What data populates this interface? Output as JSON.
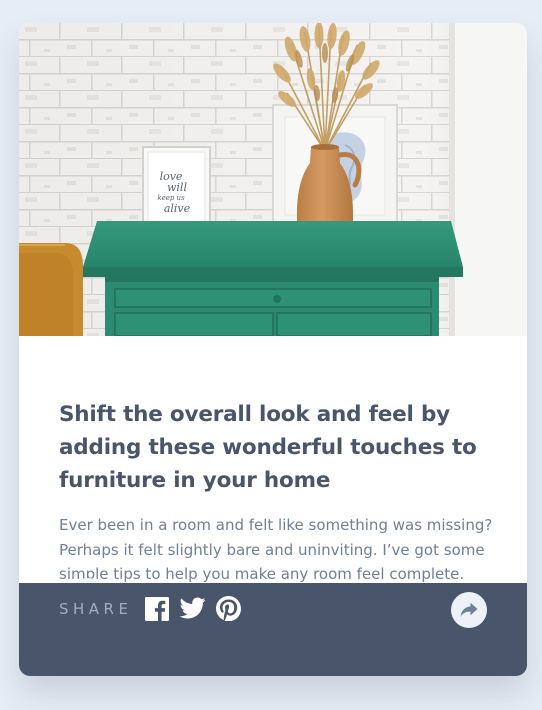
{
  "article": {
    "title": "Shift the overall look and feel by adding these wonderful touches to furniture in your home",
    "description": "Ever been in a room and felt like something was missing? Perhaps it felt slightly bare and uninviting. I’ve got some simple tips to help you make any room feel complete.",
    "image": {
      "frame_text": [
        "love",
        "will",
        "keep us",
        "alive"
      ]
    }
  },
  "footer": {
    "share_label": "SHARE",
    "social_icons": [
      "facebook-icon",
      "twitter-icon",
      "pinterest-icon"
    ],
    "share_button_icon": "share-arrow-icon"
  },
  "colors": {
    "page_background": "#e6edf6",
    "card_background": "#ffffff",
    "title": "#48556a",
    "description": "#6e8098",
    "footer_background": "#48556a",
    "share_label": "#9eafc2",
    "share_button": "#ecf2f8",
    "cabinet_green": "#2b8a6f",
    "vase": "#c78e57"
  }
}
